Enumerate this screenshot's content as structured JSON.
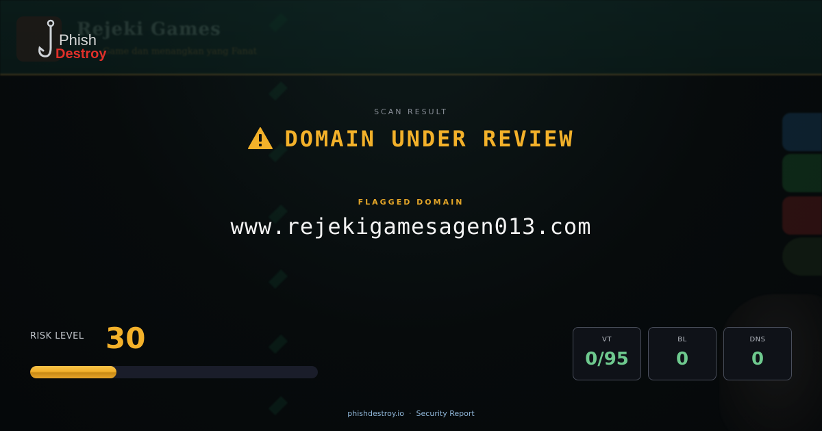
{
  "background_site": {
    "title": "Rejeki Games",
    "tagline": "Game dan menangkan yang Fanat"
  },
  "logo": {
    "line1": "Phish",
    "line2": "Destroy"
  },
  "scan": {
    "label": "SCAN RESULT",
    "status": "DOMAIN UNDER REVIEW",
    "status_icon": "warning-triangle-icon"
  },
  "flagged": {
    "label": "FLAGGED DOMAIN",
    "domain": "www.rejekigamesagen013.com"
  },
  "risk": {
    "label": "RISK LEVEL",
    "score": "30",
    "fill_fraction": 0.3
  },
  "stats": [
    {
      "label": "VT",
      "value": "0/95"
    },
    {
      "label": "BL",
      "value": "0"
    },
    {
      "label": "DNS",
      "value": "0"
    }
  ],
  "footer": {
    "site": "phishdestroy.io",
    "separator": "·",
    "report": "Security Report"
  },
  "colors": {
    "accent": "#f3b12a",
    "safe": "#6ec98e",
    "brand_red": "#e0302a"
  }
}
